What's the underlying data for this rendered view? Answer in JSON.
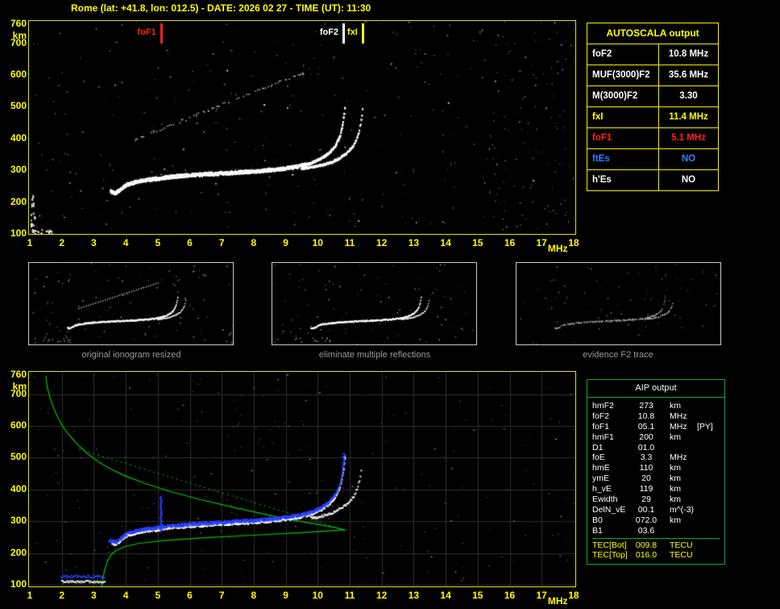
{
  "title": "Rome (lat: +41.8, lon: 012.5) - DATE: 2026 02 27 - TIME (UT): 11:30",
  "top_plot": {
    "y_axis": {
      "unit": "km",
      "ticks": [
        760,
        700,
        600,
        500,
        400,
        300,
        200,
        100
      ]
    },
    "x_axis": {
      "unit": "MHz",
      "ticks": [
        1,
        2,
        3,
        4,
        5,
        6,
        7,
        8,
        9,
        10,
        11,
        12,
        13,
        14,
        15,
        16,
        17,
        18
      ]
    },
    "markers": [
      {
        "id": "fof1",
        "label": "foF1",
        "freq_mhz": 5.1,
        "color": "#ff2020"
      },
      {
        "id": "fof2",
        "label": "foF2",
        "freq_mhz": 10.8,
        "color": "#ffffff"
      },
      {
        "id": "fxi",
        "label": "fxI",
        "freq_mhz": 11.4,
        "color": "#ffff00"
      }
    ]
  },
  "bottom_plot": {
    "y_axis": {
      "unit": "km",
      "ticks": [
        760,
        700,
        600,
        500,
        400,
        300,
        200,
        100
      ]
    },
    "x_axis": {
      "unit": "MHz",
      "ticks": [
        1,
        2,
        3,
        4,
        5,
        6,
        7,
        8,
        9,
        10,
        11,
        12,
        13,
        14,
        15,
        16,
        17,
        18
      ]
    }
  },
  "autoscala": {
    "title": "AUTOSCALA output",
    "rows": [
      {
        "label": "foF2",
        "value": "10.8 MHz",
        "color": "#ffffff"
      },
      {
        "label": "MUF(3000)F2",
        "value": "35.6 MHz",
        "color": "#ffffff"
      },
      {
        "label": "M(3000)F2",
        "value": "3.30",
        "color": "#ffffff"
      },
      {
        "label": "fxI",
        "value": "11.4 MHz",
        "color": "#ffff00"
      },
      {
        "label": "foF1",
        "value": "5.1 MHz",
        "color": "#ff2020"
      },
      {
        "label": "ftEs",
        "value": "NO",
        "color": "#2e7bff"
      },
      {
        "label": "h'Es",
        "value": "NO",
        "color": "#ffffff"
      }
    ]
  },
  "thumbnails": [
    {
      "caption": "original ionogram resized"
    },
    {
      "caption": "eliminate multiple reflections"
    },
    {
      "caption": "evidence F2 trace"
    }
  ],
  "aip": {
    "title": "AIP output",
    "rows": [
      {
        "label": "hmF2",
        "value": "273",
        "unit": "km",
        "extra": ""
      },
      {
        "label": "foF2",
        "value": "10.8",
        "unit": "MHz",
        "extra": ""
      },
      {
        "label": "foF1",
        "value": "05.1",
        "unit": "MHz",
        "extra": "[PY]"
      },
      {
        "label": "hmF1",
        "value": "200",
        "unit": "km",
        "extra": ""
      },
      {
        "label": "D1",
        "value": "01.0",
        "unit": "",
        "extra": ""
      },
      {
        "label": "foE",
        "value": "3.3",
        "unit": "MHz",
        "extra": ""
      },
      {
        "label": "hmE",
        "value": "110",
        "unit": "km",
        "extra": ""
      },
      {
        "label": "ymE",
        "value": "20",
        "unit": "km",
        "extra": ""
      },
      {
        "label": "h_vE",
        "value": "119",
        "unit": "km",
        "extra": ""
      },
      {
        "label": "Ewidth",
        "value": "29",
        "unit": "km",
        "extra": ""
      },
      {
        "label": "DelN_vE",
        "value": "00.1",
        "unit": "m^(-3)",
        "extra": ""
      },
      {
        "label": "B0",
        "value": "072.0",
        "unit": "km",
        "extra": ""
      },
      {
        "label": "B1",
        "value": "03.6",
        "unit": "",
        "extra": ""
      }
    ],
    "tec_rows": [
      {
        "label": "TEC[Bot]",
        "value": "009.8",
        "unit": "TECU"
      },
      {
        "label": "TEC[Top]",
        "value": "016.0",
        "unit": "TECU"
      }
    ]
  },
  "colors": {
    "accent_yellow": "#ffff00",
    "accent_green": "#00aa44",
    "marker_red": "#ff2020",
    "es_blue": "#2e7bff",
    "trace_blue": "#2840ff",
    "profile_green": "#00c800"
  }
}
